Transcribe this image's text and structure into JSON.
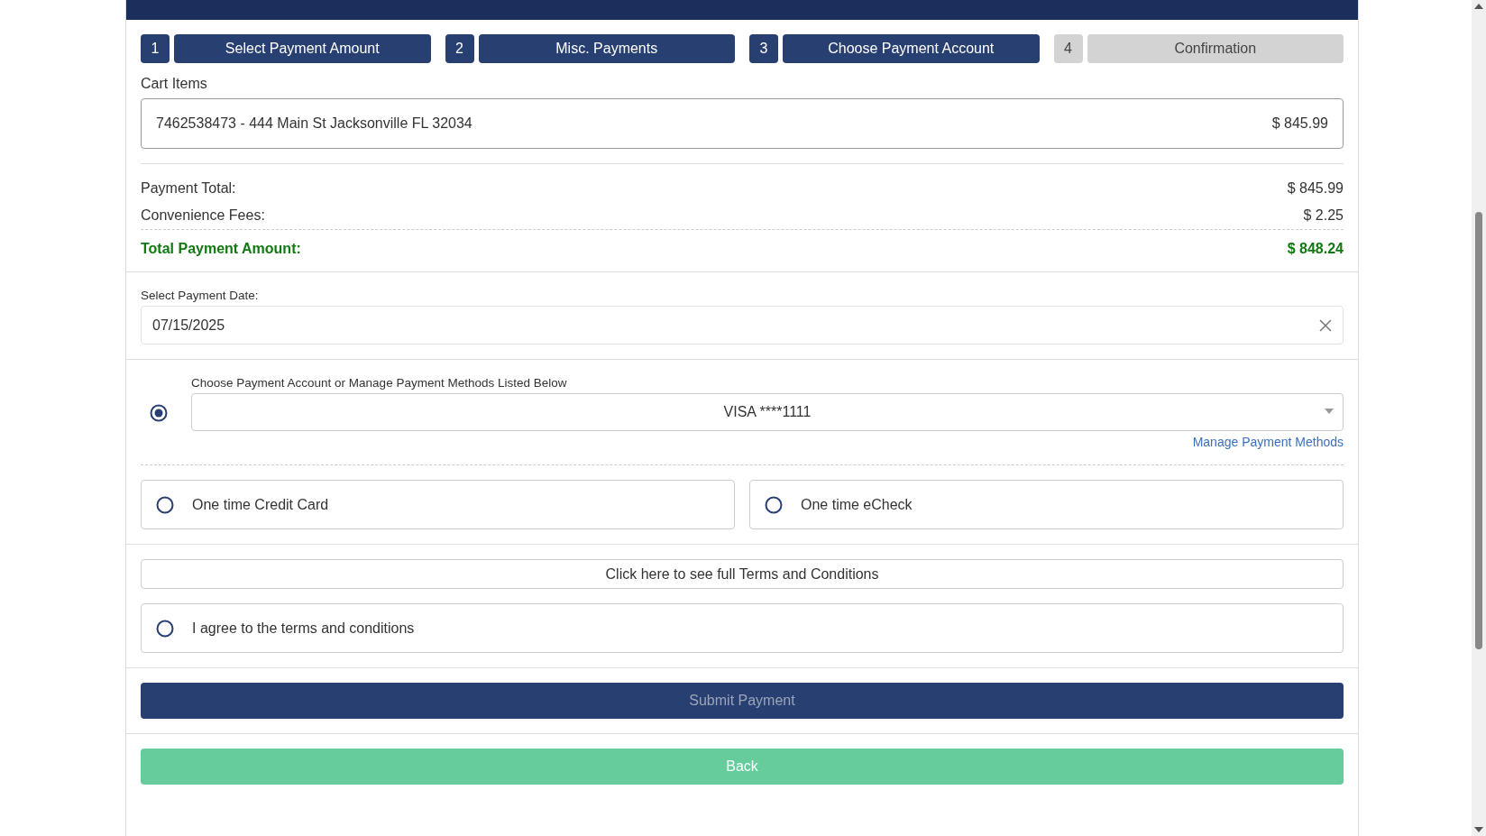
{
  "steps": [
    {
      "number": "1",
      "label": "Select Payment Amount",
      "done": true
    },
    {
      "number": "2",
      "label": "Misc. Payments",
      "done": true
    },
    {
      "number": "3",
      "label": "Choose Payment Account",
      "done": true
    },
    {
      "number": "4",
      "label": "Confirmation",
      "done": false
    }
  ],
  "cart": {
    "label": "Cart Items",
    "items": [
      {
        "description": "7462538473 - 444 Main St Jacksonville FL 32034",
        "amount": "$ 845.99"
      }
    ]
  },
  "summary": [
    {
      "label": "Payment Total:",
      "value": "$ 845.99"
    },
    {
      "label": "Convenience Fees:",
      "value": "$ 2.25"
    }
  ],
  "total": {
    "label": "Total Payment Amount:",
    "value": "$ 848.24"
  },
  "payment_date": {
    "label": "Select Payment Date:",
    "value": "07/15/2025"
  },
  "account": {
    "label": "Choose Payment Account or Manage Payment Methods Listed Below",
    "value": "VISA ****1111",
    "selected": true,
    "link": "Manage Payment Methods"
  },
  "one_time_options": [
    {
      "label": "One time Credit Card",
      "selected": false
    },
    {
      "label": "One time eCheck",
      "selected": false
    }
  ],
  "terms": {
    "button": "Click here to see full Terms and Conditions",
    "agree_label": "I agree to the terms and conditions",
    "checked": false
  },
  "submit": {
    "label": "Submit Payment",
    "disabled": true
  },
  "back": {
    "label": "Back",
    "disabled": true
  }
}
